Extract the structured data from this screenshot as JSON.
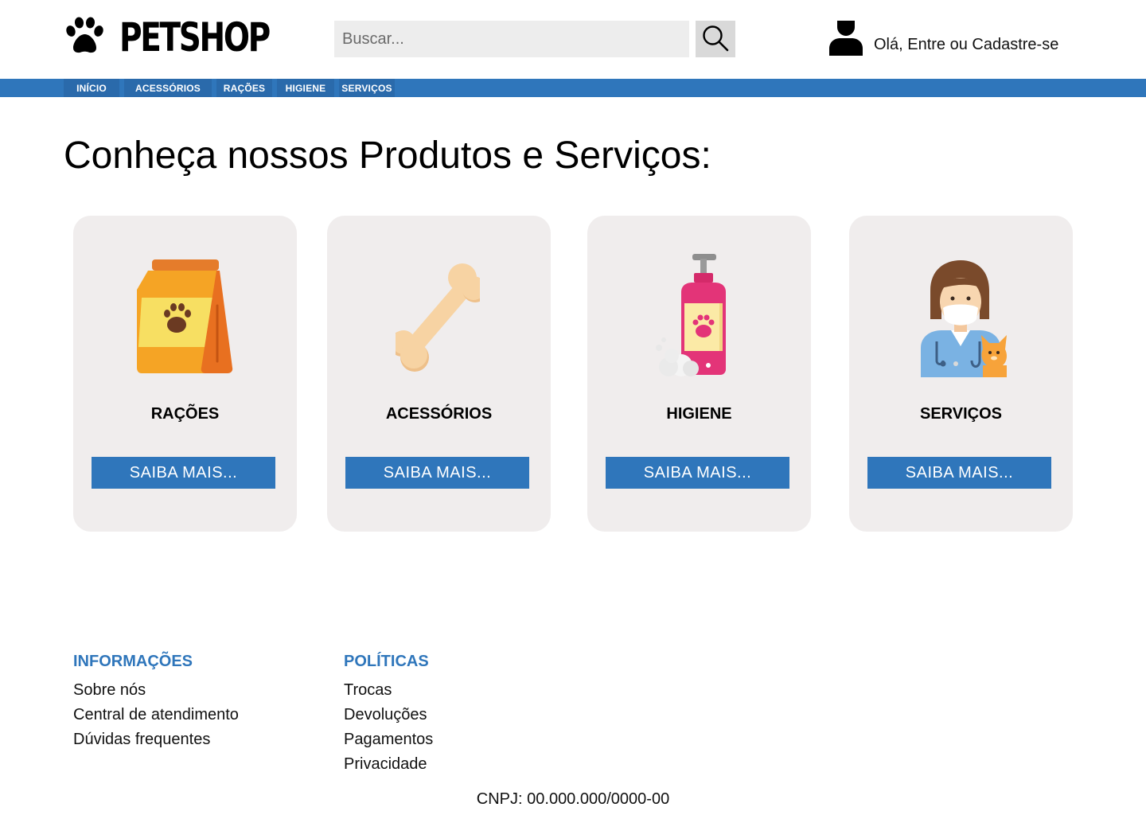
{
  "header": {
    "logo_text": "PETSHOP",
    "logo_icon": "paw-icon",
    "search": {
      "placeholder": "Buscar...",
      "value": "",
      "icon": "search-icon"
    },
    "user": {
      "icon": "user-icon",
      "text": "Olá, Entre ou Cadastre-se"
    }
  },
  "nav": {
    "items": [
      {
        "label": "INÍCIO"
      },
      {
        "label": "ACESSÓRIOS"
      },
      {
        "label": "RAÇÕES"
      },
      {
        "label": "HIGIENE"
      },
      {
        "label": "SERVIÇOS"
      }
    ]
  },
  "main": {
    "title": "Conheça nossos Produtos e Serviços:",
    "cards": [
      {
        "title": "RAÇÕES",
        "icon": "pet-food-bag-icon",
        "button": "SAIBA MAIS..."
      },
      {
        "title": "ACESSÓRIOS",
        "icon": "bone-icon",
        "button": "SAIBA MAIS..."
      },
      {
        "title": "HIGIENE",
        "icon": "shampoo-bottle-icon",
        "button": "SAIBA MAIS..."
      },
      {
        "title": "SERVIÇOS",
        "icon": "veterinarian-icon",
        "button": "SAIBA MAIS..."
      }
    ]
  },
  "footer": {
    "info": {
      "heading": "INFORMAÇÕES",
      "links": [
        "Sobre nós",
        "Central de atendimento",
        "Dúvidas frequentes"
      ]
    },
    "policies": {
      "heading": "POLÍTICAS",
      "links": [
        "Trocas",
        "Devoluções",
        "Pagamentos",
        "Privacidade"
      ]
    },
    "cnpj": "CNPJ: 00.000.000/0000-00"
  },
  "colors": {
    "primary_blue": "#2f76bb",
    "card_background": "#f0eded",
    "search_background": "#ededed"
  }
}
